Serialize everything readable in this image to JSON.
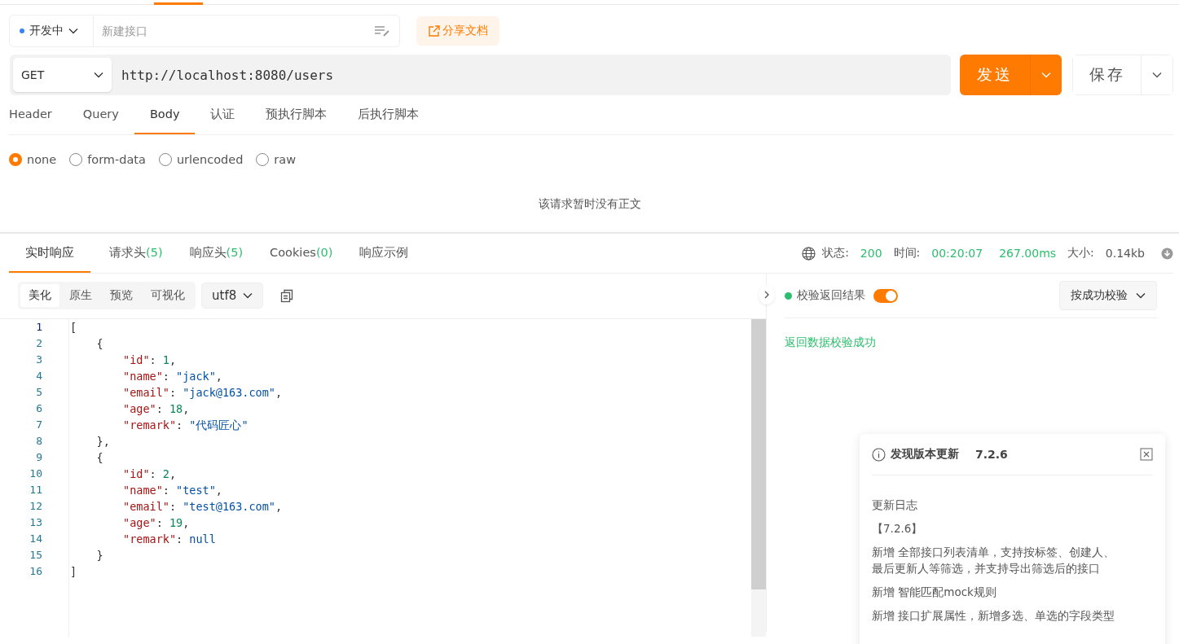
{
  "request": {
    "environment": {
      "label": "开发中",
      "color": "#3b82f6"
    },
    "name_field": {
      "placeholder": "新建接口"
    },
    "share_button": "分享文档",
    "method": "GET",
    "url": "http://localhost:8080/users",
    "send_button": "发送",
    "save_button": "保存"
  },
  "request_tabs": [
    {
      "label": "Header",
      "selected": false
    },
    {
      "label": "Query",
      "selected": false
    },
    {
      "label": "Body",
      "selected": true
    },
    {
      "label": "认证",
      "selected": false
    },
    {
      "label": "预执行脚本",
      "selected": false
    },
    {
      "label": "后执行脚本",
      "selected": false
    }
  ],
  "body_types": [
    {
      "label": "none",
      "selected": true
    },
    {
      "label": "form-data",
      "selected": false
    },
    {
      "label": "urlencoded",
      "selected": false
    },
    {
      "label": "raw",
      "selected": false
    }
  ],
  "body_empty_text": "该请求暂时没有正文",
  "response_tabs": [
    {
      "label": "实时响应",
      "selected": true
    },
    {
      "label": "请求头",
      "count": "(5)",
      "selected": false
    },
    {
      "label": "响应头",
      "count": "(5)",
      "selected": false
    },
    {
      "label": "Cookies",
      "count": "(0)",
      "selected": false
    },
    {
      "label": "响应示例",
      "selected": false
    }
  ],
  "status_bar": {
    "status_label": "状态:",
    "status": "200",
    "time_label": "时间:",
    "time": "00:20:07",
    "duration": "267.00ms",
    "size_label": "大小:",
    "size": "0.14kb"
  },
  "view_modes": [
    {
      "label": "美化",
      "selected": true
    },
    {
      "label": "原生",
      "selected": false
    },
    {
      "label": "预览",
      "selected": false
    },
    {
      "label": "可视化",
      "selected": false
    }
  ],
  "encoding": "utf8",
  "code_lines": [
    {
      "number": "1",
      "tokens": [
        {
          "kind": "punct",
          "text": "["
        }
      ]
    },
    {
      "number": "2",
      "tokens": [
        {
          "kind": "punct",
          "text": "    {"
        }
      ]
    },
    {
      "number": "3",
      "tokens": [
        {
          "kind": "key",
          "text": "        \"id\""
        },
        {
          "kind": "punct",
          "text": ": "
        },
        {
          "kind": "number",
          "text": "1"
        },
        {
          "kind": "punct",
          "text": ","
        }
      ]
    },
    {
      "number": "4",
      "tokens": [
        {
          "kind": "key",
          "text": "        \"name\""
        },
        {
          "kind": "punct",
          "text": ": "
        },
        {
          "kind": "string",
          "text": "\"jack\""
        },
        {
          "kind": "punct",
          "text": ","
        }
      ]
    },
    {
      "number": "5",
      "tokens": [
        {
          "kind": "key",
          "text": "        \"email\""
        },
        {
          "kind": "punct",
          "text": ": "
        },
        {
          "kind": "string",
          "text": "\"jack@163.com\""
        },
        {
          "kind": "punct",
          "text": ","
        }
      ]
    },
    {
      "number": "6",
      "tokens": [
        {
          "kind": "key",
          "text": "        \"age\""
        },
        {
          "kind": "punct",
          "text": ": "
        },
        {
          "kind": "number",
          "text": "18"
        },
        {
          "kind": "punct",
          "text": ","
        }
      ]
    },
    {
      "number": "7",
      "tokens": [
        {
          "kind": "key",
          "text": "        \"remark\""
        },
        {
          "kind": "punct",
          "text": ": "
        },
        {
          "kind": "string",
          "text": "\"代码匠心\""
        }
      ]
    },
    {
      "number": "8",
      "tokens": [
        {
          "kind": "punct",
          "text": "    },"
        }
      ]
    },
    {
      "number": "9",
      "tokens": [
        {
          "kind": "punct",
          "text": "    {"
        }
      ]
    },
    {
      "number": "10",
      "tokens": [
        {
          "kind": "key",
          "text": "        \"id\""
        },
        {
          "kind": "punct",
          "text": ": "
        },
        {
          "kind": "number",
          "text": "2"
        },
        {
          "kind": "punct",
          "text": ","
        }
      ]
    },
    {
      "number": "11",
      "tokens": [
        {
          "kind": "key",
          "text": "        \"name\""
        },
        {
          "kind": "punct",
          "text": ": "
        },
        {
          "kind": "string",
          "text": "\"test\""
        },
        {
          "kind": "punct",
          "text": ","
        }
      ]
    },
    {
      "number": "12",
      "tokens": [
        {
          "kind": "key",
          "text": "        \"email\""
        },
        {
          "kind": "punct",
          "text": ": "
        },
        {
          "kind": "string",
          "text": "\"test@163.com\""
        },
        {
          "kind": "punct",
          "text": ","
        }
      ]
    },
    {
      "number": "13",
      "tokens": [
        {
          "kind": "key",
          "text": "        \"age\""
        },
        {
          "kind": "punct",
          "text": ": "
        },
        {
          "kind": "number",
          "text": "19"
        },
        {
          "kind": "punct",
          "text": ","
        }
      ]
    },
    {
      "number": "14",
      "tokens": [
        {
          "kind": "key",
          "text": "        \"remark\""
        },
        {
          "kind": "punct",
          "text": ": "
        },
        {
          "kind": "null",
          "text": "null"
        }
      ]
    },
    {
      "number": "15",
      "tokens": [
        {
          "kind": "punct",
          "text": "    }"
        }
      ]
    },
    {
      "number": "16",
      "tokens": [
        {
          "kind": "punct",
          "text": "]"
        }
      ]
    }
  ],
  "validation": {
    "label": "校验返回结果",
    "on": true,
    "mode": "按成功校验",
    "result": "返回数据校验成功"
  },
  "update_notice": {
    "title": "发现版本更新",
    "version": "7.2.6",
    "heading": "更新日志",
    "items": [
      "【7.2.6】",
      "新增 全部接口列表清单，支持按标签、创建人、最后更新人等筛选，并支持导出筛选后的接口",
      "新增 智能匹配mock规则",
      "新增 接口扩展属性，新增多选、单选的字段类型"
    ]
  }
}
